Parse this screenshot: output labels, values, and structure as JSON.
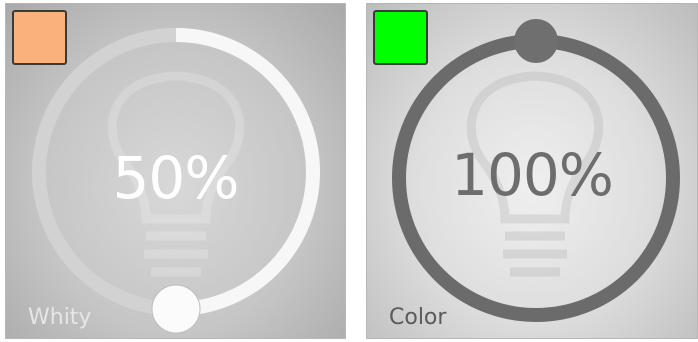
{
  "tiles": [
    {
      "id": "whity",
      "color_swatch": "#f9b27c",
      "value_text": "50%",
      "level": 0.5,
      "mode_label": "Whity"
    },
    {
      "id": "color",
      "color_swatch": "#00ff00",
      "value_text": "100%",
      "level": 1.0,
      "mode_label": "Color"
    }
  ],
  "icons": [
    "lightbulb-icon",
    "lightbulb-icon"
  ],
  "colors": {
    "whity_ring_fill": "#f7f7f7",
    "whity_ring_track": "#d2d2d2",
    "color_ring": "#6b6b6b"
  }
}
